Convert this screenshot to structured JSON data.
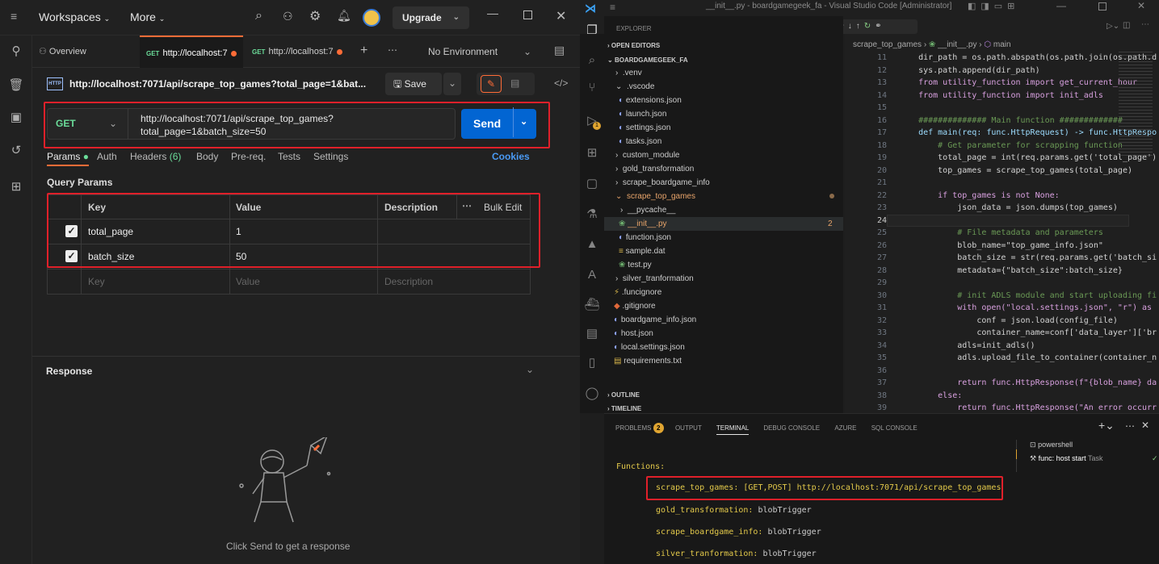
{
  "postman": {
    "topbar": {
      "workspaces": "Workspaces",
      "more": "More",
      "upgrade": "Upgrade"
    },
    "tabs": [
      {
        "label": "Overview"
      },
      {
        "method": "GET",
        "label": "http://localhost:7",
        "unsaved": true
      },
      {
        "method": "GET",
        "label": "http://localhost:7",
        "unsaved": true
      }
    ],
    "environment": "No Environment",
    "request": {
      "title": "http://localhost:7071/api/scrape_top_games?total_page=1&bat...",
      "save_label": "Save",
      "method": "GET",
      "url_line1": "http://localhost:7071/api/scrape_top_games?",
      "url_line2": "total_page=1&batch_size=50",
      "send_label": "Send"
    },
    "subtabs": {
      "params": "Params",
      "auth": "Auth",
      "headers": "Headers",
      "headers_count": "(6)",
      "body": "Body",
      "prereq": "Pre-req.",
      "tests": "Tests",
      "settings": "Settings",
      "cookies": "Cookies"
    },
    "query_params": {
      "heading": "Query Params",
      "columns": {
        "key": "Key",
        "value": "Value",
        "description": "Description",
        "bulk_edit": "Bulk Edit"
      },
      "rows": [
        {
          "key": "total_page",
          "value": "1",
          "checked": true
        },
        {
          "key": "batch_size",
          "value": "50",
          "checked": true
        }
      ],
      "placeholders": {
        "key": "Key",
        "value": "Value",
        "description": "Description"
      }
    },
    "response": {
      "heading": "Response",
      "hint": "Click Send to get a response"
    },
    "colors": {
      "accent": "#ff6c37",
      "send": "#0265d2",
      "method_get": "#6bdd9a",
      "highlight": "#e0202a"
    }
  },
  "vscode": {
    "title": "__init__.py - boardgamegeek_fa - Visual Studio Code [Administrator]",
    "explorer": {
      "heading": "EXPLORER",
      "open_editors": "OPEN EDITORS",
      "root": "BOARDGAMEGEEK_FA",
      "items": [
        {
          "label": ".venv"
        },
        {
          "label": ".vscode"
        },
        {
          "label": "extensions.json"
        },
        {
          "label": "launch.json"
        },
        {
          "label": "settings.json"
        },
        {
          "label": "tasks.json"
        },
        {
          "label": "custom_module"
        },
        {
          "label": "gold_transformation"
        },
        {
          "label": "scrape_boardgame_info"
        },
        {
          "label": "scrape_top_games"
        },
        {
          "label": "__pycache__"
        },
        {
          "label": "__init__.py",
          "badge": "2"
        },
        {
          "label": "function.json"
        },
        {
          "label": "sample.dat"
        },
        {
          "label": "test.py"
        },
        {
          "label": "silver_tranformation"
        },
        {
          "label": ".funcignore"
        },
        {
          "label": ".gitignore"
        },
        {
          "label": "boardgame_info.json"
        },
        {
          "label": "host.json"
        },
        {
          "label": "local.settings.json"
        },
        {
          "label": "requirements.txt"
        }
      ],
      "outline": "OUTLINE",
      "timeline": "TIMELINE"
    },
    "breadcrumb": {
      "folder": "scrape_top_games",
      "file": "__init__.py",
      "symbol": "main"
    },
    "code": [
      {
        "n": "11",
        "t": "    dir_path = os.path.abspath(os.path.join(os.path.d"
      },
      {
        "n": "12",
        "t": "    sys.path.append(dir_path)"
      },
      {
        "n": "13",
        "t": "    from utility_function import get_current_hour"
      },
      {
        "n": "14",
        "t": "    from utility_function import init_adls"
      },
      {
        "n": "15",
        "t": ""
      },
      {
        "n": "16",
        "t": "    ############## Main function #############"
      },
      {
        "n": "17",
        "t": "    def main(req: func.HttpRequest) -> func.HttpRespo"
      },
      {
        "n": "18",
        "t": "        # Get parameter for scrapping function"
      },
      {
        "n": "19",
        "t": "        total_page = int(req.params.get('total_page')"
      },
      {
        "n": "20",
        "t": "        top_games = scrape_top_games(total_page)"
      },
      {
        "n": "21",
        "t": ""
      },
      {
        "n": "22",
        "t": "        if top_games is not None:"
      },
      {
        "n": "23",
        "t": "            json_data = json.dumps(top_games)"
      },
      {
        "n": "24",
        "t": ""
      },
      {
        "n": "25",
        "t": "            # File metadata and parameters"
      },
      {
        "n": "26",
        "t": "            blob_name=\"top_game_info.json\""
      },
      {
        "n": "27",
        "t": "            batch_size = str(req.params.get('batch_si"
      },
      {
        "n": "28",
        "t": "            metadata={\"batch_size\":batch_size}"
      },
      {
        "n": "29",
        "t": ""
      },
      {
        "n": "30",
        "t": "            # init ADLS module and start uploading fi"
      },
      {
        "n": "31",
        "t": "            with open(\"local.settings.json\", \"r\") as"
      },
      {
        "n": "32",
        "t": "                conf = json.load(config_file)"
      },
      {
        "n": "33",
        "t": "                container_name=conf['data_layer']['br"
      },
      {
        "n": "34",
        "t": "            adls=init_adls()"
      },
      {
        "n": "35",
        "t": "            adls.upload_file_to_container(container_n"
      },
      {
        "n": "36",
        "t": ""
      },
      {
        "n": "37",
        "t": "            return func.HttpResponse(f\"{blob_name} da"
      },
      {
        "n": "38",
        "t": "        else:"
      },
      {
        "n": "39",
        "t": "            return func.HttpResponse(\"An error occurr"
      },
      {
        "n": "40",
        "t": ""
      }
    ],
    "panel": {
      "tabs": [
        "PROBLEMS",
        "OUTPUT",
        "TERMINAL",
        "DEBUG CONSOLE",
        "AZURE",
        "SQL CONSOLE"
      ],
      "problems_count": "2",
      "active_tab": "TERMINAL",
      "terminals": [
        "powershell",
        "func: host start"
      ],
      "task_label": "Task",
      "functions_heading": "Functions:",
      "functions": [
        {
          "name": "scrape_top_games:",
          "detail": "[GET,POST] http://localhost:7071/api/scrape_top_games"
        },
        {
          "name": "gold_transformation:",
          "detail": "blobTrigger"
        },
        {
          "name": "scrape_boardgame_info:",
          "detail": "blobTrigger"
        },
        {
          "name": "silver_tranformation:",
          "detail": "blobTrigger"
        }
      ]
    }
  }
}
